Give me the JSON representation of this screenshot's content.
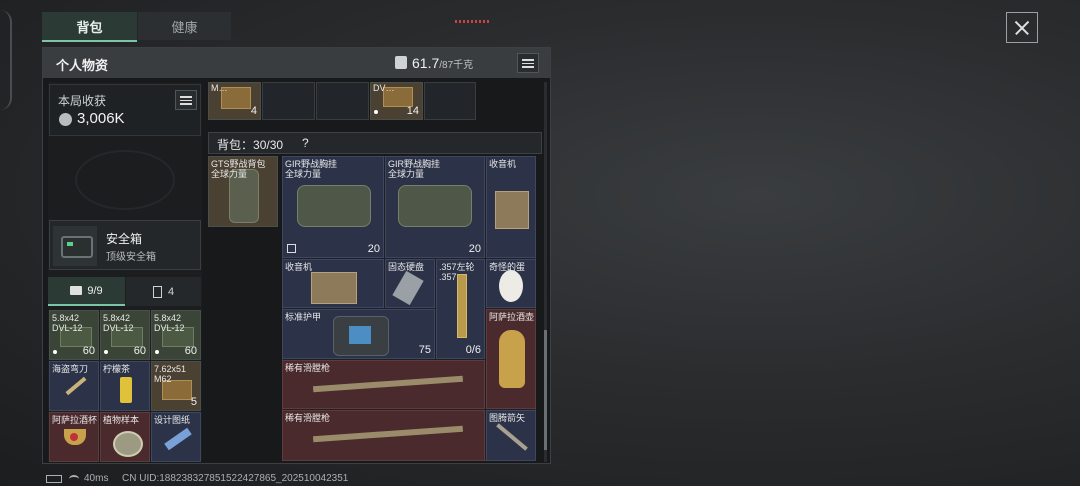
{
  "tabs": [
    {
      "label": "背包"
    },
    {
      "label": "健康"
    }
  ],
  "panel": {
    "title": "个人物资",
    "weight_value": "61.7",
    "weight_max": "/87千克"
  },
  "stat": {
    "label": "本局收获",
    "value": "3,006K"
  },
  "safe_box": {
    "title": "安全箱",
    "subtitle": "顶级安全箱"
  },
  "sub_tabs": [
    {
      "label": "9/9"
    },
    {
      "label": "4"
    }
  ],
  "top_row": [
    {
      "label": "M…",
      "count": "4"
    },
    {
      "label": "",
      "count": ""
    },
    {
      "label": "",
      "count": ""
    },
    {
      "label": "DV…",
      "count": "14"
    },
    {
      "label": "",
      "count": ""
    }
  ],
  "backpack": {
    "label": "背包：",
    "capacity": "30/30",
    "help": "?"
  },
  "left_items": [
    {
      "label": "5.8x42\nDVL-12",
      "count": "60"
    },
    {
      "label": "5.8x42\nDVL-12",
      "count": "60"
    },
    {
      "label": "5.8x42\nDVL-12",
      "count": "60"
    },
    {
      "label": "海盗弯刀",
      "count": ""
    },
    {
      "label": "柠檬茶",
      "count": ""
    },
    {
      "label": "7.62x51\nM62",
      "count": "5"
    },
    {
      "label": "阿萨拉酒杯",
      "count": ""
    },
    {
      "label": "植物样本",
      "count": ""
    },
    {
      "label": "设计图纸",
      "count": ""
    }
  ],
  "bag_item": {
    "label": "GTS野战背包\n全球力量"
  },
  "grid_items": {
    "vest1": {
      "label": "GIR野战胸挂\n全球力量",
      "durability": "20"
    },
    "vest2": {
      "label": "GIR野战胸挂\n全球力量",
      "durability": "20"
    },
    "radio1": {
      "label": "收音机"
    },
    "radio2": {
      "label": "收音机"
    },
    "ssd": {
      "label": "固态硬盘"
    },
    "revolver": {
      "label": ".357左轮\n.357",
      "ammo": "0/6"
    },
    "egg": {
      "label": "奇怪的蛋"
    },
    "armor": {
      "label": "标准护甲",
      "durability": "75"
    },
    "pot": {
      "label": "阿萨拉酒壶"
    },
    "musket1": {
      "label": "稀有滑膛枪"
    },
    "musket2": {
      "label": "稀有滑膛枪"
    },
    "arrow": {
      "label": "图腾箭矢"
    }
  },
  "status": {
    "ping": "40ms",
    "uid": "CN UID:188238327851522427865_202510042351"
  },
  "colors": {
    "accent": "#7ac6a6",
    "rare_red": "#4a2a2c",
    "epic_blue": "#2c3348"
  }
}
